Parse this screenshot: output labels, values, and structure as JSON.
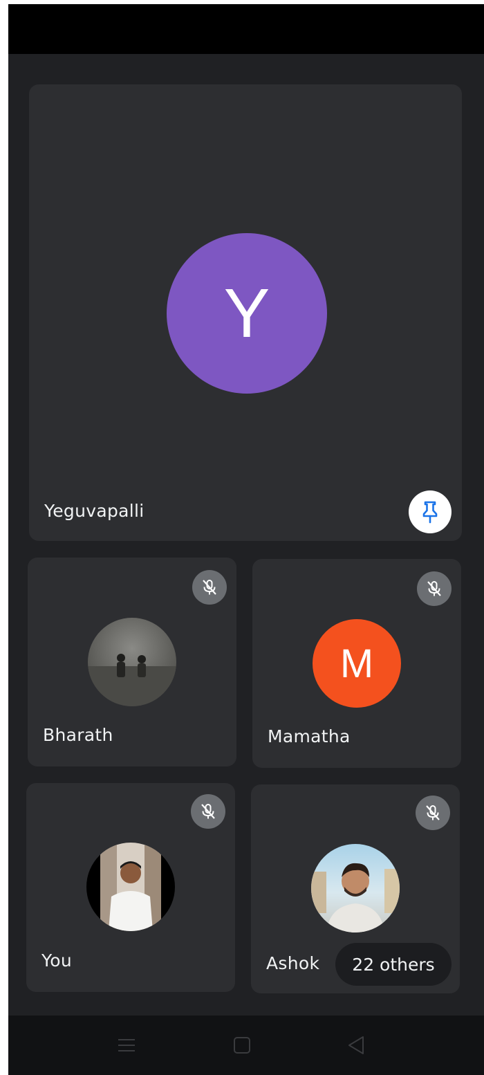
{
  "main_tile": {
    "initial": "Y",
    "name": "Yeguvapalli",
    "avatar_color": "#7e57c2",
    "pin_icon": "pin-icon"
  },
  "participants": [
    {
      "name": "Bharath",
      "avatar": "photo",
      "muted": true
    },
    {
      "name": "Mamatha",
      "initial": "M",
      "avatar_color": "#f4511e",
      "muted": true
    },
    {
      "name": "You",
      "avatar": "photo",
      "muted": true
    },
    {
      "name": "Ashok",
      "avatar": "photo",
      "muted": true
    }
  ],
  "others_label": "22 others",
  "nav": {
    "menu_icon": "menu-icon",
    "home_icon": "home-icon",
    "back_icon": "back-icon"
  },
  "colors": {
    "background": "#202124",
    "tile": "#2d2e31",
    "pin": "#1a73e8",
    "mute_bg": "#6b6e72"
  }
}
